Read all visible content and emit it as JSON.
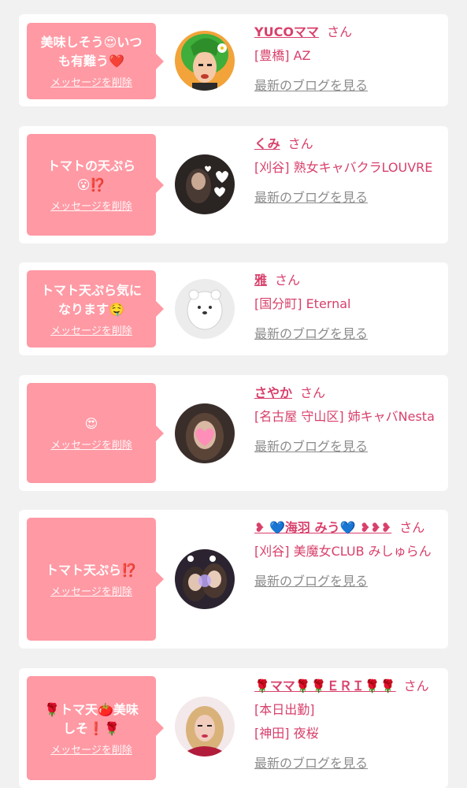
{
  "items": [
    {
      "message": "美味しそう😍いつ\nも有難う❤️",
      "delete_label": "メッセージを削除",
      "name": "YUCOママ",
      "suffix": "さん",
      "shop": "[豊橋] AZ",
      "blog_link": "最新のブログを見る",
      "avatar_desc": "green-hair-illustration"
    },
    {
      "message": "トマトの天ぷら\n😮⁉️",
      "delete_label": "メッセージを削除",
      "name": "くみ",
      "suffix": "さん",
      "shop": "[刈谷] 熟女キャバクラLOUVRE",
      "blog_link": "最新のブログを見る",
      "avatar_desc": "photo-with-hearts"
    },
    {
      "message": "トマト天ぷら気に\nなります🤤",
      "delete_label": "メッセージを削除",
      "name": "雅",
      "suffix": "さん",
      "shop": "[国分町] Eternal",
      "blog_link": "最新のブログを見る",
      "avatar_desc": "white-bear-figure"
    },
    {
      "message": "😍",
      "delete_label": "メッセージを削除",
      "name": "さやか",
      "suffix": "さん",
      "shop": "[名古屋 守山区] 姉キャバNesta",
      "blog_link": "最新のブログを見る",
      "avatar_desc": "photo-with-pink-heart"
    },
    {
      "message": "トマト天ぷら⁉️",
      "delete_label": "メッセージを削除",
      "name": "❥ 💙海羽 みう💙 ❥❥❥",
      "suffix": "さん",
      "shop": "[刈谷] 美魔女CLUB みしゅらん",
      "blog_link": "最新のブログを見る",
      "avatar_desc": "two-women-photo"
    },
    {
      "message": "🌹トマ天🍅美味\nしそ❗️🌹",
      "delete_label": "メッセージを削除",
      "name": "🌹ママ🌹🌹ＥＲＩ🌹🌹",
      "suffix": "さん[本日出勤]",
      "shop": "[神田] 夜桜",
      "blog_link": "最新のブログを見る",
      "avatar_desc": "blonde-woman-photo"
    }
  ],
  "colors": {
    "accent": "#d8406b",
    "bubble": "#ff99a4",
    "link_gray": "#8c8c8c",
    "background": "#f1f1f1"
  }
}
